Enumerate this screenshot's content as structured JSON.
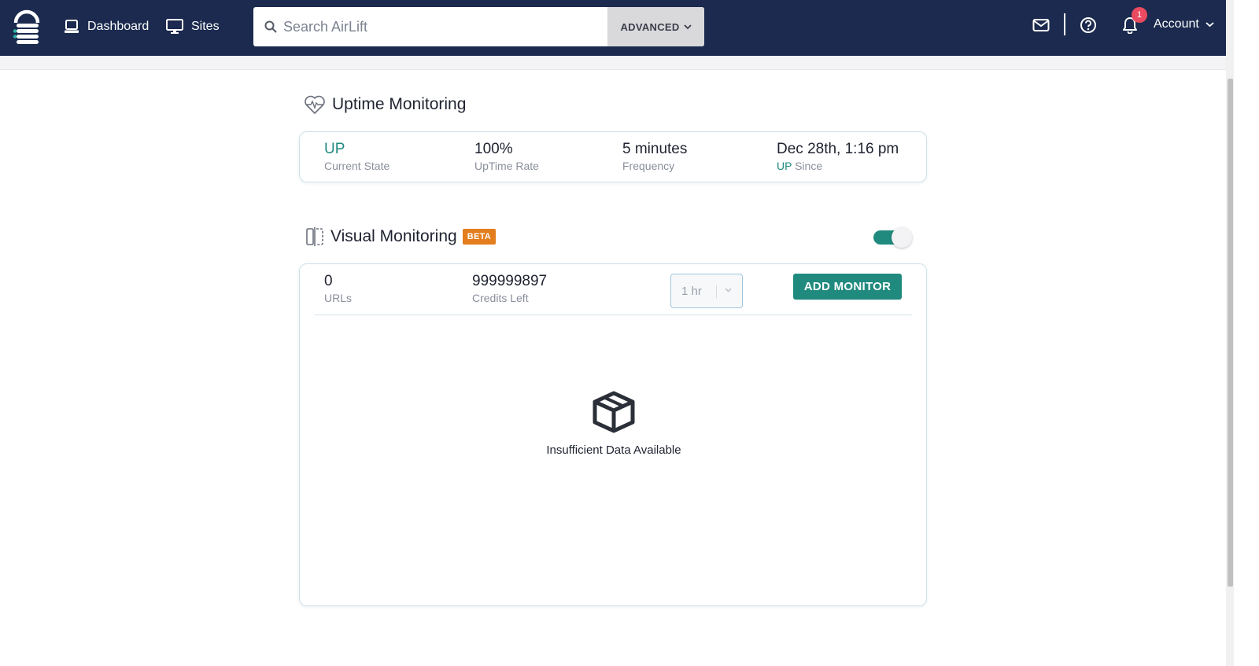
{
  "nav": {
    "links": [
      {
        "label": "Dashboard",
        "icon": "laptop-icon"
      },
      {
        "label": "Sites",
        "icon": "monitor-icon"
      }
    ],
    "search": {
      "placeholder": "Search AirLift",
      "advanced_label": "ADVANCED"
    },
    "notifications_count": "1",
    "account_label": "Account"
  },
  "uptime": {
    "title": "Uptime Monitoring",
    "stats": [
      {
        "value": "UP",
        "label": "Current State"
      },
      {
        "value": "100%",
        "label": "UpTime Rate"
      },
      {
        "value": "5 minutes",
        "label": "Frequency"
      },
      {
        "value": "Dec 28th, 1:16 pm",
        "label_up": "UP",
        "label": " Since"
      }
    ]
  },
  "visual": {
    "title": "Visual Monitoring",
    "badge": "BETA",
    "toggle_on": true,
    "stats": [
      {
        "value": "0",
        "label": "URLs"
      },
      {
        "value": "999999897",
        "label": "Credits Left"
      }
    ],
    "interval": "1 hr",
    "add_button": "ADD MONITOR",
    "empty_message": "Insufficient Data Available"
  },
  "colors": {
    "navbar": "#1b2a4e",
    "accent": "#218a7f",
    "badge": "#e37d1d",
    "notification": "#e94a5f"
  }
}
